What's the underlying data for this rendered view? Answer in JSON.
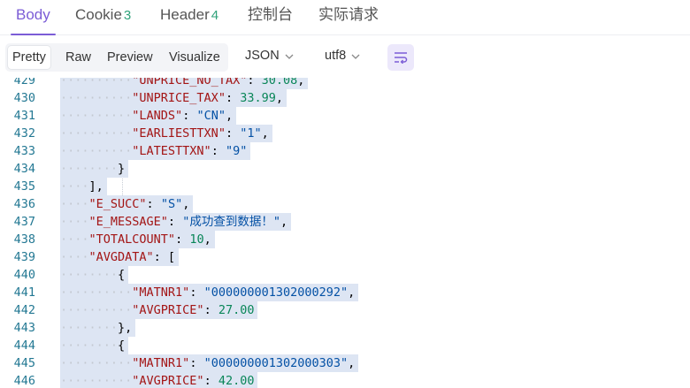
{
  "tabs": [
    {
      "label": "Body",
      "badge": "",
      "active": true
    },
    {
      "label": "Cookie",
      "badge": "3",
      "active": false
    },
    {
      "label": "Header",
      "badge": "4",
      "active": false
    },
    {
      "label": "控制台",
      "badge": "",
      "active": false
    },
    {
      "label": "实际请求",
      "badge": "",
      "active": false
    }
  ],
  "toolbar": {
    "view_modes": [
      "Pretty",
      "Raw",
      "Preview",
      "Visualize"
    ],
    "active_view": "Pretty",
    "format": "JSON",
    "encoding": "utf8",
    "wrap_icon": "wrap-lines-icon"
  },
  "colors": {
    "accent": "#7b5cd6",
    "key": "#a31515",
    "string": "#0451a5",
    "number": "#098658"
  },
  "code_lines": [
    {
      "n": "429",
      "indent": 5,
      "tokens": [
        {
          "t": "k",
          "v": "\"UNPRICE_NO_TAX\""
        },
        {
          "t": "p",
          "v": ": "
        },
        {
          "t": "n",
          "v": "30.08"
        },
        {
          "t": "p",
          "v": ","
        }
      ]
    },
    {
      "n": "430",
      "indent": 5,
      "tokens": [
        {
          "t": "k",
          "v": "\"UNPRICE_TAX\""
        },
        {
          "t": "p",
          "v": ": "
        },
        {
          "t": "n",
          "v": "33.99"
        },
        {
          "t": "p",
          "v": ","
        }
      ]
    },
    {
      "n": "431",
      "indent": 5,
      "tokens": [
        {
          "t": "k",
          "v": "\"LANDS\""
        },
        {
          "t": "p",
          "v": ": "
        },
        {
          "t": "s",
          "v": "\"CN\""
        },
        {
          "t": "p",
          "v": ","
        }
      ]
    },
    {
      "n": "432",
      "indent": 5,
      "tokens": [
        {
          "t": "k",
          "v": "\"EARLIESTTXN\""
        },
        {
          "t": "p",
          "v": ": "
        },
        {
          "t": "s",
          "v": "\"1\""
        },
        {
          "t": "p",
          "v": ","
        }
      ]
    },
    {
      "n": "433",
      "indent": 5,
      "tokens": [
        {
          "t": "k",
          "v": "\"LATESTTXN\""
        },
        {
          "t": "p",
          "v": ": "
        },
        {
          "t": "s",
          "v": "\"9\""
        }
      ]
    },
    {
      "n": "434",
      "indent": 4,
      "tokens": [
        {
          "t": "p",
          "v": "}"
        }
      ]
    },
    {
      "n": "435",
      "indent": 2,
      "tokens": [
        {
          "t": "p",
          "v": "],"
        }
      ]
    },
    {
      "n": "436",
      "indent": 2,
      "tokens": [
        {
          "t": "k",
          "v": "\"E_SUCC\""
        },
        {
          "t": "p",
          "v": ": "
        },
        {
          "t": "s",
          "v": "\"S\""
        },
        {
          "t": "p",
          "v": ","
        }
      ]
    },
    {
      "n": "437",
      "indent": 2,
      "tokens": [
        {
          "t": "k",
          "v": "\"E_MESSAGE\""
        },
        {
          "t": "p",
          "v": ": "
        },
        {
          "t": "s",
          "v": "\"成功查到数据！\""
        },
        {
          "t": "p",
          "v": ","
        }
      ]
    },
    {
      "n": "438",
      "indent": 2,
      "tokens": [
        {
          "t": "k",
          "v": "\"TOTALCOUNT\""
        },
        {
          "t": "p",
          "v": ": "
        },
        {
          "t": "n",
          "v": "10"
        },
        {
          "t": "p",
          "v": ","
        }
      ]
    },
    {
      "n": "439",
      "indent": 2,
      "tokens": [
        {
          "t": "k",
          "v": "\"AVGDATA\""
        },
        {
          "t": "p",
          "v": ": ["
        }
      ]
    },
    {
      "n": "440",
      "indent": 4,
      "tokens": [
        {
          "t": "p",
          "v": "{"
        }
      ]
    },
    {
      "n": "441",
      "indent": 5,
      "tokens": [
        {
          "t": "k",
          "v": "\"MATNR1\""
        },
        {
          "t": "p",
          "v": ": "
        },
        {
          "t": "s",
          "v": "\"000000001302000292\""
        },
        {
          "t": "p",
          "v": ","
        }
      ]
    },
    {
      "n": "442",
      "indent": 5,
      "tokens": [
        {
          "t": "k",
          "v": "\"AVGPRICE\""
        },
        {
          "t": "p",
          "v": ": "
        },
        {
          "t": "n",
          "v": "27.00"
        }
      ]
    },
    {
      "n": "443",
      "indent": 4,
      "tokens": [
        {
          "t": "p",
          "v": "},"
        }
      ]
    },
    {
      "n": "444",
      "indent": 4,
      "tokens": [
        {
          "t": "p",
          "v": "{"
        }
      ]
    },
    {
      "n": "445",
      "indent": 5,
      "tokens": [
        {
          "t": "k",
          "v": "\"MATNR1\""
        },
        {
          "t": "p",
          "v": ": "
        },
        {
          "t": "s",
          "v": "\"000000001302000303\""
        },
        {
          "t": "p",
          "v": ","
        }
      ]
    },
    {
      "n": "446",
      "indent": 5,
      "tokens": [
        {
          "t": "k",
          "v": "\"AVGPRICE\""
        },
        {
          "t": "p",
          "v": ": "
        },
        {
          "t": "n",
          "v": "42.00"
        }
      ]
    }
  ]
}
